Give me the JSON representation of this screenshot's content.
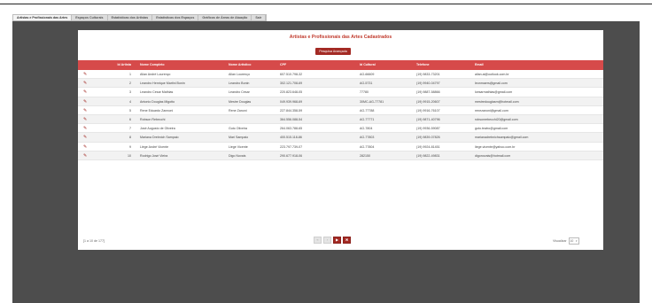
{
  "tabs": [
    {
      "label": "Artistas e Profissionais das Artes",
      "active": true
    },
    {
      "label": "Espaços Culturais",
      "active": false
    },
    {
      "label": "Estatísticas dos Artistas",
      "active": false
    },
    {
      "label": "Estatísticas dos Espaços",
      "active": false
    },
    {
      "label": "Gráficos de Áreas de Atuação",
      "active": false
    },
    {
      "label": "Sair",
      "active": false
    }
  ],
  "panel": {
    "title": "Artistas e Profissionais das Artes Cadastrados",
    "advanced_search_label": "Pesquisa Avançada"
  },
  "table": {
    "columns": [
      "Id Artista",
      "Nome Completo",
      "Nome Artístico",
      "CPF",
      "Id Cultural",
      "Telefone",
      "Email"
    ],
    "rows": [
      [
        "1",
        "Allan André Lourenço",
        "Allan Lourenço",
        "607.510.798-32",
        "AG-66609",
        "(19) 9833-73201",
        "allan.al@outlook.com.br"
      ],
      [
        "2",
        "Leandro Henrique Martini Bonin",
        "Leandro Bonin",
        "302.121.708-69",
        "AG-5731",
        "(19) 9940-04797",
        "leonmaers@gmail.com"
      ],
      [
        "3",
        "Leandro Cesar Mathias",
        "Leandro Cesar",
        "220.823.648-05",
        "77780",
        "(19) 9887-58866",
        "lcesarmathias@gmail.com"
      ],
      [
        "4",
        "Antonio Douglas Migotto",
        "Mestre Douglas",
        "049.939.968-69",
        "30MC-AG-77781",
        "(19) 9915-20607",
        "mestredouglasm@hotmail.com"
      ],
      [
        "5",
        "Rene Eduardo Zannoni",
        "Rene Zanoni",
        "227.844.358-59",
        "AG-77788",
        "(19) 9916-76107",
        "renezanoni@gmail.com"
      ],
      [
        "6",
        "Robson Rebecchi",
        "",
        "364.556.088-54",
        "AG-77771",
        "(19) 9871-40796",
        "robsonrebecchi20@gmail.com"
      ],
      [
        "7",
        "José Augusto de Oliveira",
        "Guto Oliveira",
        "264.063.788-65",
        "AG-7804",
        "(19) 9936-59087",
        "guto.teatro@gmail.com"
      ],
      [
        "8",
        "Mariana Drebnich Sampaio",
        "Mari Sampaio",
        "400.515.118-86",
        "AG-77803",
        "(19) 9839-07826",
        "marianadrebnichsampaio@gmail.com"
      ],
      [
        "9",
        "Liége André Vicente",
        "Liege Vicente",
        "223.797.739-07",
        "AG-77804",
        "(19) 9924-81451",
        "liege.vicente@yahoo.com.br"
      ],
      [
        "10",
        "Rodrigo José Vieira",
        "Digo Novais",
        "290.677.918-06",
        "282150",
        "(19) 9822-49831",
        "digonovais@hotmail.com"
      ]
    ]
  },
  "footer": {
    "count_text": "[1 a 10 de 177]",
    "view_label": "Visualizar",
    "page_size": "10"
  },
  "colors": {
    "header": "#d64a4a",
    "accent": "#a32a24",
    "workspace": "#4d4d4d"
  },
  "icons": {
    "edit": "pencil-icon",
    "first": "first-page-icon",
    "prev": "prev-page-icon",
    "next": "next-page-icon",
    "last": "last-page-icon"
  }
}
